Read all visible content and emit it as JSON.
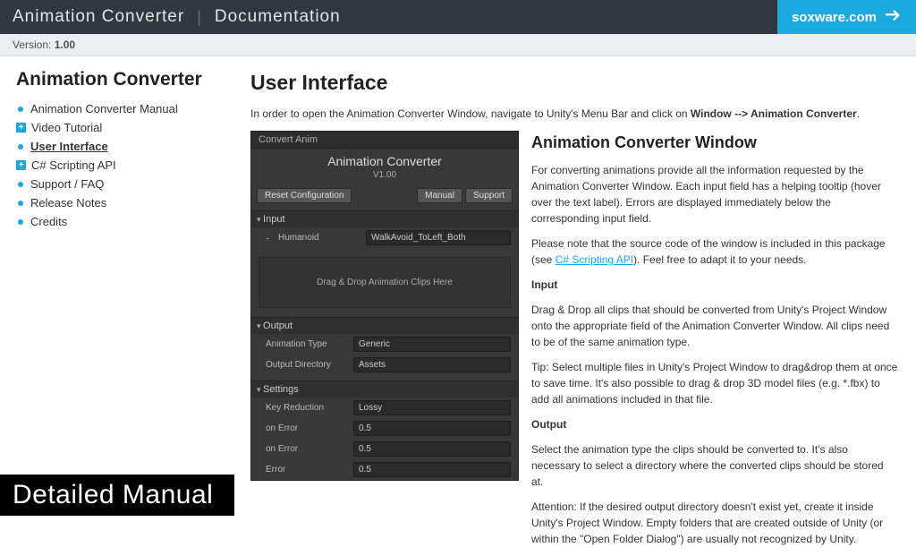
{
  "topbar": {
    "title_left": "Animation Converter",
    "title_right": "Documentation",
    "link": "soxware.com"
  },
  "version": {
    "label": "Version:",
    "value": "1.00"
  },
  "sidebar": {
    "heading": "Animation Converter",
    "items": [
      {
        "label": "Animation Converter Manual",
        "bullet": "dot",
        "active": false
      },
      {
        "label": "Video Tutorial",
        "bullet": "plus",
        "active": false
      },
      {
        "label": "User Interface",
        "bullet": "dot",
        "active": true
      },
      {
        "label": "C# Scripting API",
        "bullet": "plus",
        "active": false
      },
      {
        "label": "Support / FAQ",
        "bullet": "dot",
        "active": false
      },
      {
        "label": "Release Notes",
        "bullet": "dot",
        "active": false
      },
      {
        "label": "Credits",
        "bullet": "dot",
        "active": false
      }
    ]
  },
  "content": {
    "h1": "User Interface",
    "intro_pre": "In order to open the Animation Converter Window, navigate to Unity's Menu Bar and click on ",
    "intro_bold": "Window --> Animation Converter",
    "intro_post": "."
  },
  "panel": {
    "tab": "Convert Anim",
    "title": "Animation Converter",
    "version": "V1.00",
    "reset": "Reset Configuration",
    "manual": "Manual",
    "support": "Support",
    "input_hdr": "Input",
    "input_row": {
      "label": "Humanoid",
      "value": "WalkAvoid_ToLeft_Both"
    },
    "dropzone": "Drag & Drop Animation Clips Here",
    "output_hdr": "Output",
    "out_type": {
      "label": "Animation Type",
      "value": "Generic"
    },
    "out_dir": {
      "label": "Output Directory",
      "value": "Assets"
    },
    "settings_hdr": "Settings",
    "keyred": {
      "label": "Key Reduction",
      "value": "Lossy"
    },
    "err1": {
      "label": "on Error",
      "value": "0.5"
    },
    "err2": {
      "label": "on Error",
      "value": "0.5"
    },
    "err3": {
      "label": "Error",
      "value": "0.5"
    }
  },
  "right": {
    "h2": "Animation Converter Window",
    "p1": "For converting animations provide all the information requested by the Animation Converter Window. Each input field has a helping tooltip (hover over the text label). Errors are displayed immediately below the corresponding input field.",
    "p2a": "Please note that the source code of the window is included in this package (see ",
    "p2link": "C# Scripting API",
    "p2b": "). Feel free to adapt it to your needs.",
    "h_input": "Input",
    "p3": "Drag & Drop all clips that should be converted from Unity's Project Window onto the appropriate field of the Animation Converter Window. All clips need to be of the same animation type.",
    "p4": "Tip: Select multiple files in Unity's Project Window to drag&drop them at once to save time. It's also possible to drag & drop 3D model files (e.g. *.fbx) to add all animations included in that file.",
    "h_output": "Output",
    "p5": "Select the animation type the clips should be converted to. It's also necessary to select a directory where the converted clips should be stored at.",
    "p6": "Attention: If the desired output directory doesn't exist yet, create it inside Unity's Project Window. Empty folders that are created outside of Unity (or within the \"Open Folder Dialog\") are usually not recognized by Unity."
  },
  "banner": "Detailed Manual"
}
